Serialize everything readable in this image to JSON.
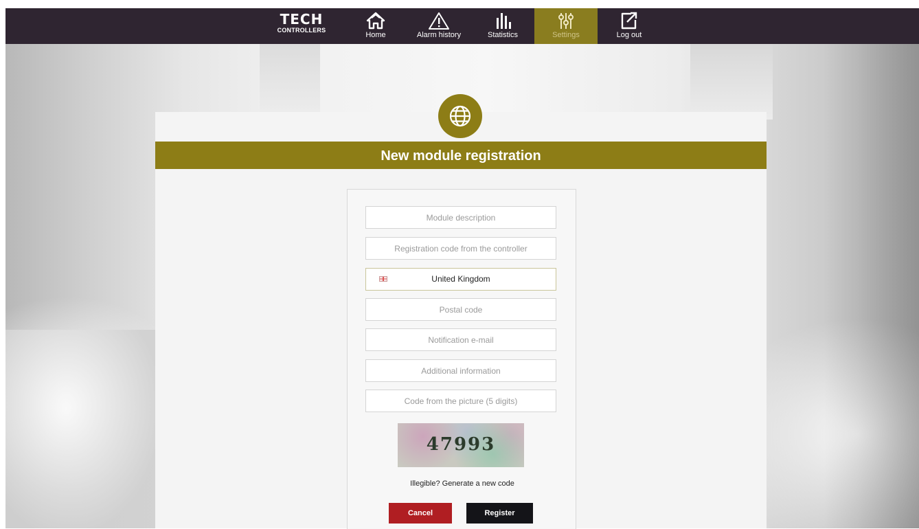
{
  "brand": {
    "logo_main": "TECH",
    "logo_sub": "CONTROLLERS"
  },
  "nav": {
    "items": [
      {
        "label": "Home",
        "icon": "home-icon"
      },
      {
        "label": "Alarm history",
        "icon": "warning-icon"
      },
      {
        "label": "Statistics",
        "icon": "bar-chart-icon"
      },
      {
        "label": "Settings",
        "icon": "sliders-icon",
        "active": true
      },
      {
        "label": "Log out",
        "icon": "logout-icon"
      }
    ]
  },
  "page": {
    "title": "New module registration",
    "icon": "globe-icon"
  },
  "form": {
    "module_description_placeholder": "Module description",
    "registration_code_placeholder": "Registration code from the controller",
    "country": "United Kingdom",
    "postal_code_placeholder": "Postal code",
    "notification_email_placeholder": "Notification e-mail",
    "additional_info_placeholder": "Additional information",
    "captcha_input_placeholder": "Code from the picture (5 digits)",
    "captcha_image_code": "47993",
    "regenerate_link": "Illegible? Generate a new code",
    "cancel_label": "Cancel",
    "register_label": "Register"
  },
  "colors": {
    "topbar": "#2f2531",
    "accent_olive": "#8d7d16",
    "cancel_red": "#b01e22",
    "register_black": "#141418"
  }
}
